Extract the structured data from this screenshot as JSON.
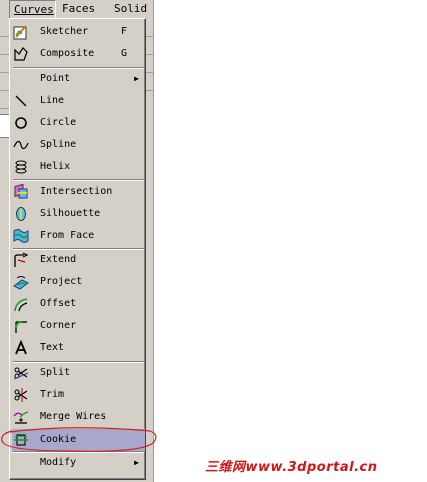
{
  "menubar": {
    "items": [
      {
        "label": "Curves"
      },
      {
        "label": "Faces"
      },
      {
        "label": "Solid"
      }
    ]
  },
  "curves_menu": {
    "items": [
      {
        "label": "Sketcher",
        "accel": "F",
        "icon": "sketcher-icon"
      },
      {
        "label": "Composite",
        "accel": "G",
        "icon": "composite-icon"
      },
      {
        "label": "Point",
        "submenu": "▶",
        "icon": "none"
      },
      {
        "label": "Line",
        "icon": "line-icon"
      },
      {
        "label": "Circle",
        "icon": "circle-icon"
      },
      {
        "label": "Spline",
        "icon": "spline-icon"
      },
      {
        "label": "Helix",
        "icon": "helix-icon"
      },
      {
        "label": "Intersection",
        "icon": "intersection-icon"
      },
      {
        "label": "Silhouette",
        "icon": "silhouette-icon"
      },
      {
        "label": "From Face",
        "icon": "from-face-icon"
      },
      {
        "label": "Extend",
        "icon": "extend-icon"
      },
      {
        "label": "Project",
        "icon": "project-icon"
      },
      {
        "label": "Offset",
        "icon": "offset-icon"
      },
      {
        "label": "Corner",
        "icon": "corner-icon"
      },
      {
        "label": "Text",
        "icon": "text-icon"
      },
      {
        "label": "Split",
        "icon": "split-icon"
      },
      {
        "label": "Trim",
        "icon": "trim-icon"
      },
      {
        "label": "Merge Wires",
        "icon": "merge-wires-icon"
      },
      {
        "label": "Cookie",
        "icon": "cookie-icon",
        "highlighted": true
      },
      {
        "label": "Modify",
        "submenu": "▶",
        "icon": "none"
      }
    ]
  },
  "colors": {
    "menu_bg": "#d4d0c8",
    "highlight": "#a8a8cc",
    "annotation": "#d02020",
    "watermark": "#d01818"
  },
  "watermark": {
    "text": "三维网www.3dportal.cn"
  }
}
